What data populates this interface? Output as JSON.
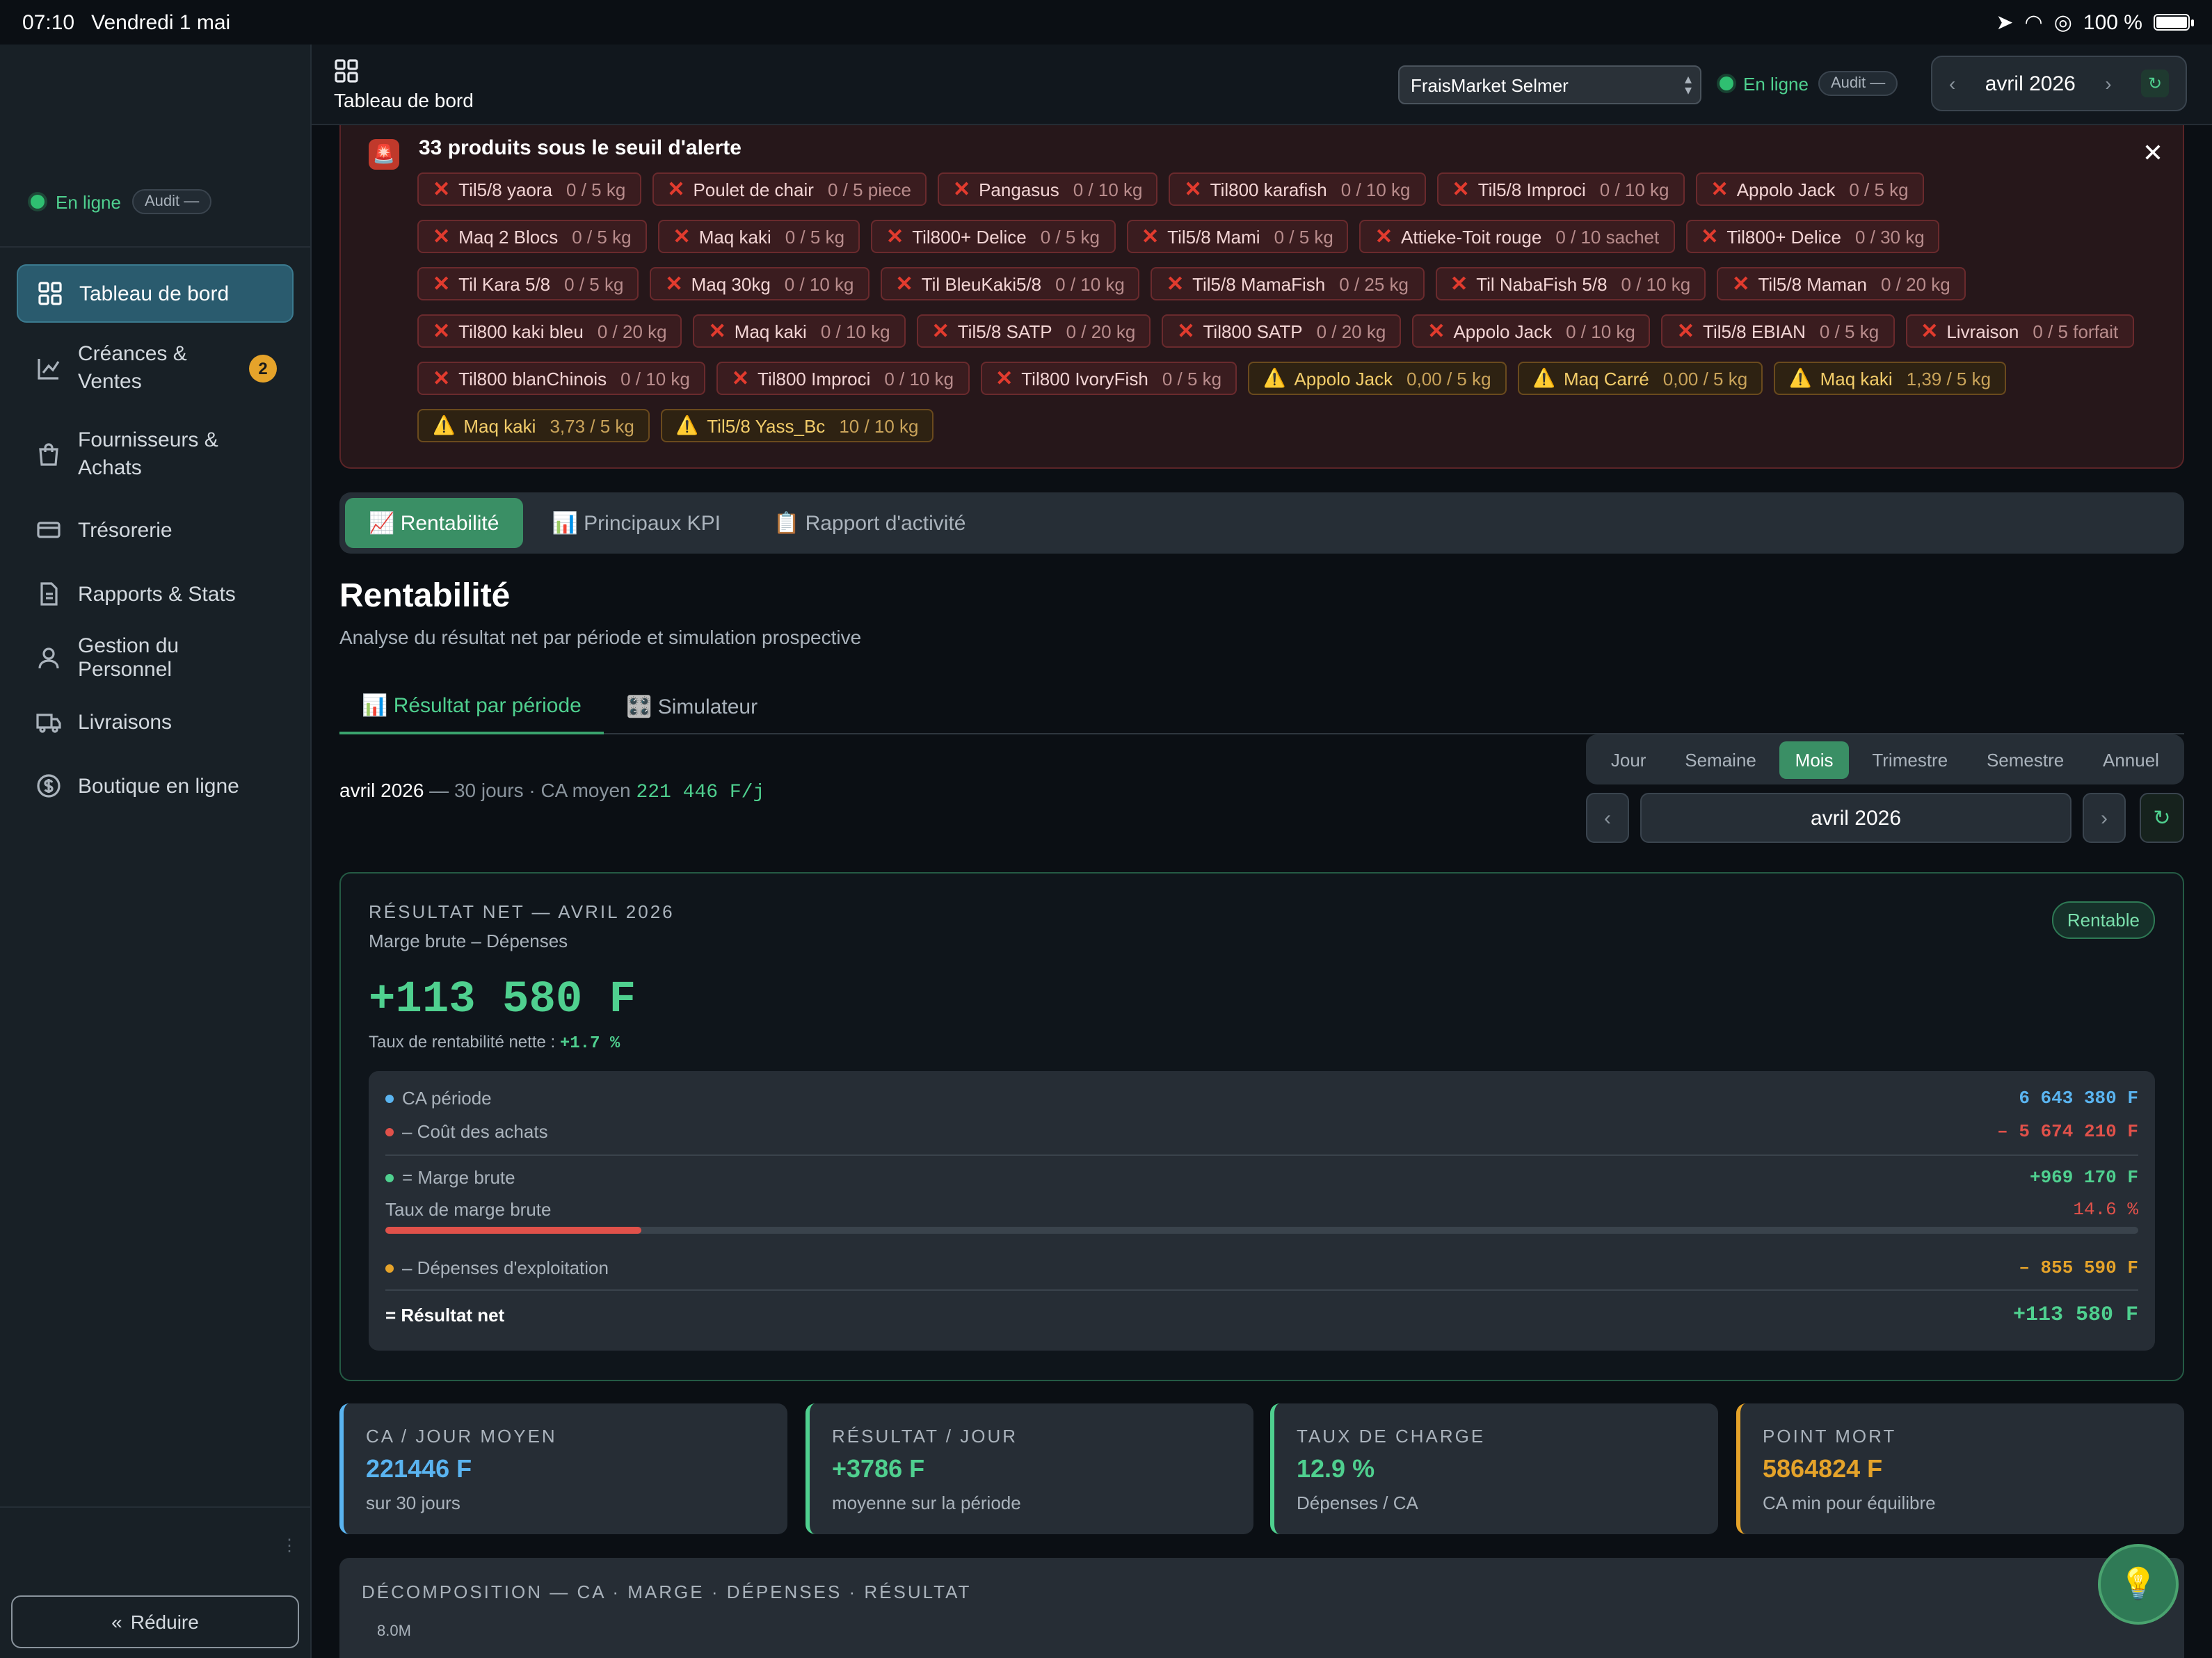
{
  "status_bar": {
    "time": "07:10",
    "date": "Vendredi 1 mai",
    "battery": "100 %"
  },
  "sidebar": {
    "status": "En ligne",
    "audit": "Audit —",
    "items": [
      {
        "label": "Tableau de bord",
        "icon": "grid-icon"
      },
      {
        "label": "Créances &\nVentes",
        "icon": "chart-line-icon",
        "badge": "2"
      },
      {
        "label": "Fournisseurs &\nAchats",
        "icon": "bag-icon"
      },
      {
        "label": "Trésorerie",
        "icon": "card-icon"
      },
      {
        "label": "Rapports & Stats",
        "icon": "document-icon"
      },
      {
        "label": "Gestion du Personnel",
        "icon": "user-icon"
      },
      {
        "label": "Livraisons",
        "icon": "truck-icon"
      },
      {
        "label": "Boutique en ligne",
        "icon": "dollar-icon"
      }
    ],
    "reduce": "Réduire"
  },
  "topbar": {
    "title": "Tableau de bord",
    "store": "FraisMarket Selmer",
    "status": "En ligne",
    "audit": "Audit —",
    "month": "avril 2026"
  },
  "alert": {
    "title": "33 produits sous le seuil d'alerte",
    "chips": [
      {
        "name": "Til5/8 yaora",
        "value": "0 / 5 kg",
        "level": "critical"
      },
      {
        "name": "Poulet de chair",
        "value": "0 / 5 piece",
        "level": "critical"
      },
      {
        "name": "Pangasus",
        "value": "0 / 10 kg",
        "level": "critical"
      },
      {
        "name": "Til800 karafish",
        "value": "0 / 10 kg",
        "level": "critical"
      },
      {
        "name": "Til5/8 Improci",
        "value": "0 / 10 kg",
        "level": "critical"
      },
      {
        "name": "Appolo Jack",
        "value": "0 / 5 kg",
        "level": "critical"
      },
      {
        "name": "Maq 2 Blocs",
        "value": "0 / 5 kg",
        "level": "critical"
      },
      {
        "name": "Maq kaki",
        "value": "0 / 5 kg",
        "level": "critical"
      },
      {
        "name": "Til800+ Delice",
        "value": "0 / 5 kg",
        "level": "critical"
      },
      {
        "name": "Til5/8 Mami",
        "value": "0 / 5 kg",
        "level": "critical"
      },
      {
        "name": "Attieke-Toit rouge",
        "value": "0 / 10 sachet",
        "level": "critical"
      },
      {
        "name": "Til800+ Delice",
        "value": "0 / 30 kg",
        "level": "critical"
      },
      {
        "name": "Til Kara 5/8",
        "value": "0 / 5 kg",
        "level": "critical"
      },
      {
        "name": "Maq 30kg",
        "value": "0 / 10 kg",
        "level": "critical"
      },
      {
        "name": "Til BleuKaki5/8",
        "value": "0 / 10 kg",
        "level": "critical"
      },
      {
        "name": "Til5/8 MamaFish",
        "value": "0 / 25 kg",
        "level": "critical"
      },
      {
        "name": "Til NabaFish 5/8",
        "value": "0 / 10 kg",
        "level": "critical"
      },
      {
        "name": "Til5/8 Maman",
        "value": "0 / 20 kg",
        "level": "critical"
      },
      {
        "name": "Til800 kaki bleu",
        "value": "0 / 20 kg",
        "level": "critical"
      },
      {
        "name": "Maq kaki",
        "value": "0 / 10 kg",
        "level": "critical"
      },
      {
        "name": "Til5/8 SATP",
        "value": "0 / 20 kg",
        "level": "critical"
      },
      {
        "name": "Til800 SATP",
        "value": "0 / 20 kg",
        "level": "critical"
      },
      {
        "name": "Appolo Jack",
        "value": "0 / 10 kg",
        "level": "critical"
      },
      {
        "name": "Til5/8 EBIAN",
        "value": "0 / 5 kg",
        "level": "critical"
      },
      {
        "name": "Livraison",
        "value": "0 / 5 forfait",
        "level": "critical"
      },
      {
        "name": "Til800 blanChinois",
        "value": "0 / 10 kg",
        "level": "critical"
      },
      {
        "name": "Til800 Improci",
        "value": "0 / 10 kg",
        "level": "critical"
      },
      {
        "name": "Til800 IvoryFish",
        "value": "0 / 5 kg",
        "level": "critical"
      },
      {
        "name": "Appolo Jack",
        "value": "0,00 / 5 kg",
        "level": "warning"
      },
      {
        "name": "Maq Carré",
        "value": "0,00 / 5 kg",
        "level": "warning"
      },
      {
        "name": "Maq kaki",
        "value": "1,39 / 5 kg",
        "level": "warning"
      },
      {
        "name": "Maq kaki",
        "value": "3,73 / 5 kg",
        "level": "warning"
      },
      {
        "name": "Til5/8 Yass_Bc",
        "value": "10 / 10 kg",
        "level": "warning"
      }
    ]
  },
  "tabs": [
    {
      "label": "📈 Rentabilité"
    },
    {
      "label": "📊 Principaux KPI"
    },
    {
      "label": "📋 Rapport d'activité"
    }
  ],
  "page": {
    "title": "Rentabilité",
    "subtitle": "Analyse du résultat net par période et simulation prospective"
  },
  "subtabs": [
    {
      "label": "📊 Résultat par période"
    },
    {
      "label": "🎛️ Simulateur"
    }
  ],
  "period": {
    "options": [
      "Jour",
      "Semaine",
      "Mois",
      "Trimestre",
      "Semestre",
      "Annuel"
    ],
    "selected": "Mois",
    "month": "avril 2026"
  },
  "summary": {
    "month": "avril 2026",
    "days": " — 30 jours · CA moyen ",
    "avg": "221 446 F/j"
  },
  "result": {
    "label": "RÉSULTAT NET — AVRIL 2026",
    "sub": "Marge brute – Dépenses",
    "value": "+113 580 F",
    "rate_label": "Taux de rentabilité nette :",
    "rate": "+1.7 %",
    "badge": "Rentable",
    "ca_label": "CA période",
    "ca": "6 643 380 F",
    "cost_label": "– Coût des achats",
    "cost": "– 5 674 210 F",
    "margin_label": "= Marge brute",
    "margin": "+969 170 F",
    "margin_rate_label": "Taux de marge brute",
    "margin_rate": "14.6 %",
    "margin_rate_pct": 14.6,
    "exp_label": "– Dépenses d'exploitation",
    "exp": "– 855 590 F",
    "net_label": "= Résultat net",
    "net": "+113 580 F"
  },
  "kpis": [
    {
      "title": "CA / JOUR MOYEN",
      "value": "221446 F",
      "sub": "sur 30 jours",
      "color": "#5ab4f0"
    },
    {
      "title": "RÉSULTAT / JOUR",
      "value": "+3786 F",
      "sub": "moyenne sur la période",
      "color": "#4fd08f"
    },
    {
      "title": "TAUX DE CHARGE",
      "value": "12.9 %",
      "sub": "Dépenses / CA",
      "color": "#4fd08f"
    },
    {
      "title": "POINT MORT",
      "value": "5864824 F",
      "sub": "CA min pour équilibre",
      "color": "#e5a32a"
    }
  ],
  "decomp": {
    "title": "DÉCOMPOSITION — CA · MARGE · DÉPENSES · RÉSULTAT",
    "y_top": "8.0M"
  }
}
